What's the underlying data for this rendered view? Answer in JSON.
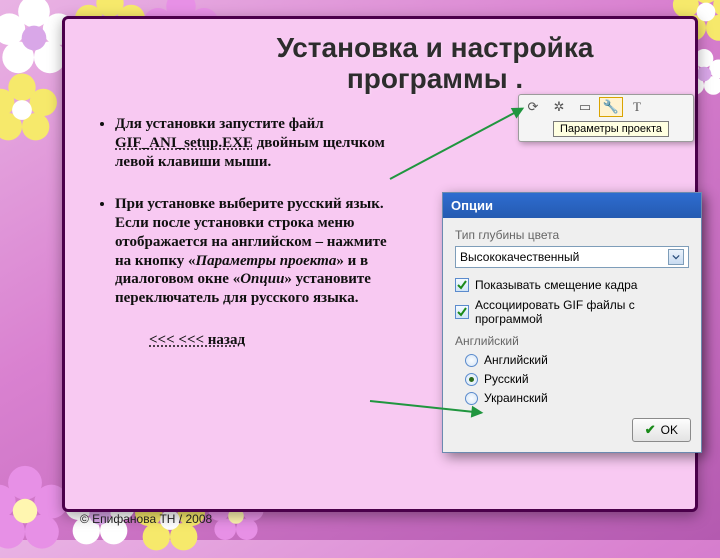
{
  "title": "Установка и настройка программы .",
  "bullets": {
    "b1a": "Для установки запустите файл ",
    "b1_file": "GIF_ANI_setup.EXE",
    "b1b": " двойным щелчком левой клавиши мыши.",
    "b2a": "При установке выберите русский язык.",
    "b2b": " Если после установки строка меню отображается на английском – нажмите на кнопку «",
    "b2c": "Параметры проекта",
    "b2d": "» и в диалоговом окне «",
    "b2e": "Опции",
    "b2f": "» установите переключатель для русского языка."
  },
  "back_link": "<<< <<< назад",
  "copyright": "© Епифанова ТН / 2008",
  "toolbar": {
    "tooltip": "Параметры проекта"
  },
  "dialog": {
    "title": "Опции",
    "depth_label": "Тип глубины цвета",
    "depth_value": "Высококачественный",
    "chk_offset": "Показывать смещение кадра",
    "chk_assoc": "Ассоциировать GIF файлы с программой",
    "lang_label": "Английский",
    "lang_en": "Английский",
    "lang_ru": "Русский",
    "lang_uk": "Украинский",
    "ok": "OK"
  }
}
